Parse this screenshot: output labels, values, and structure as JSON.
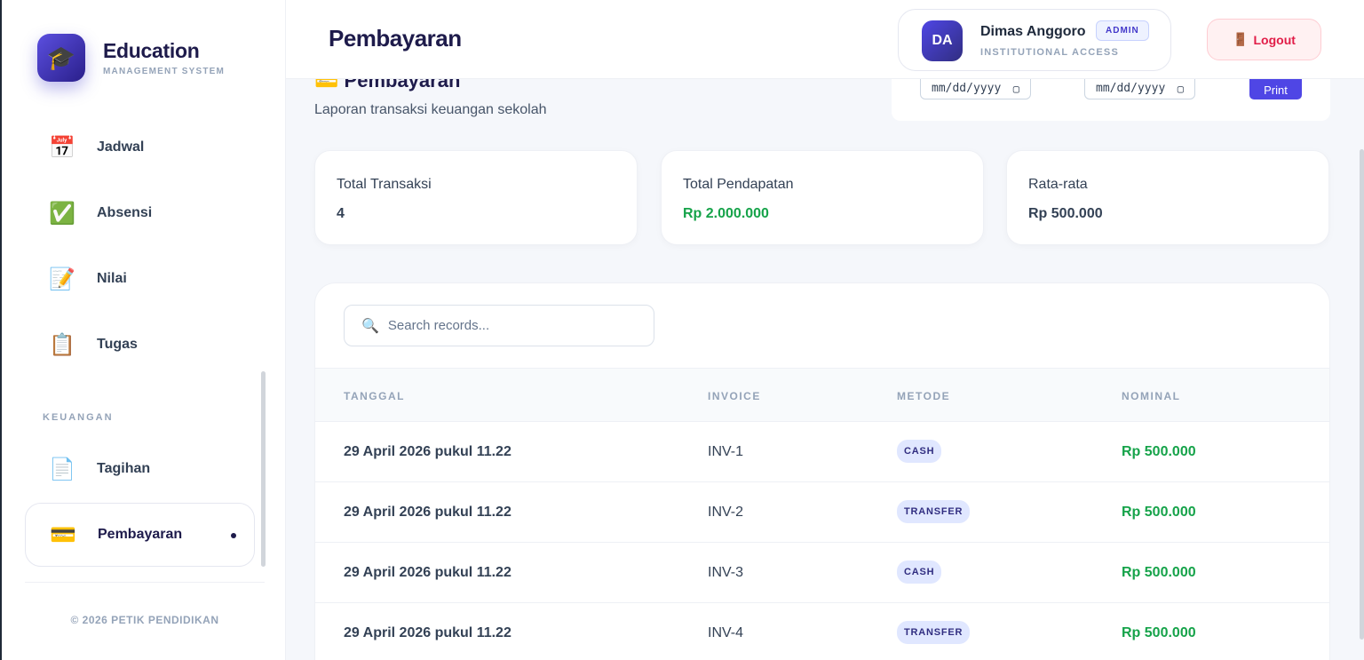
{
  "brand": {
    "name": "Education",
    "subtitle": "MANAGEMENT SYSTEM",
    "logo_icon": "graduation-cap-icon"
  },
  "sidebar": {
    "items": [
      {
        "label": "Jadwal",
        "icon": "📅"
      },
      {
        "label": "Absensi",
        "icon": "✅"
      },
      {
        "label": "Nilai",
        "icon": "📝"
      },
      {
        "label": "Tugas",
        "icon": "📋"
      }
    ],
    "section_keuangan": "KEUANGAN",
    "finance_items": [
      {
        "label": "Tagihan",
        "icon": "📄"
      },
      {
        "label": "Pembayaran",
        "icon": "💳",
        "active": true
      }
    ],
    "footer": "© 2026 PETIK PENDIDIKAN"
  },
  "header": {
    "title": "Pembayaran",
    "user": {
      "initials": "DA",
      "name": "Dimas Anggoro",
      "role": "ADMIN",
      "access": "INSTITUTIONAL ACCESS"
    },
    "logout_icon": "🚪",
    "logout_label": "Logout"
  },
  "section": {
    "icon": "💳",
    "title": "Pembayaran",
    "subtitle": "Laporan transaksi keuangan sekolah"
  },
  "filter": {
    "date_from": "mm/dd/yyyy",
    "date_to": "mm/dd/yyyy",
    "print_label": "Print"
  },
  "stats": [
    {
      "label": "Total Transaksi",
      "value": "4"
    },
    {
      "label": "Total Pendapatan",
      "value": "Rp 2.000.000"
    },
    {
      "label": "Rata-rata",
      "value": "Rp 500.000"
    }
  ],
  "table": {
    "search_placeholder": "Search records...",
    "columns": [
      "TANGGAL",
      "INVOICE",
      "METODE",
      "NOMINAL"
    ],
    "rows": [
      {
        "tanggal": "29 April 2026 pukul 11.22",
        "invoice": "INV-1",
        "metode": "CASH",
        "nominal": "Rp 500.000"
      },
      {
        "tanggal": "29 April 2026 pukul 11.22",
        "invoice": "INV-2",
        "metode": "TRANSFER",
        "nominal": "Rp 500.000"
      },
      {
        "tanggal": "29 April 2026 pukul 11.22",
        "invoice": "INV-3",
        "metode": "CASH",
        "nominal": "Rp 500.000"
      },
      {
        "tanggal": "29 April 2026 pukul 11.22",
        "invoice": "INV-4",
        "metode": "TRANSFER",
        "nominal": "Rp 500.000"
      }
    ]
  },
  "colors": {
    "primary": "#4f46e5",
    "navy": "#1e1b4b",
    "green": "#16a34a",
    "danger": "#e11d48"
  }
}
